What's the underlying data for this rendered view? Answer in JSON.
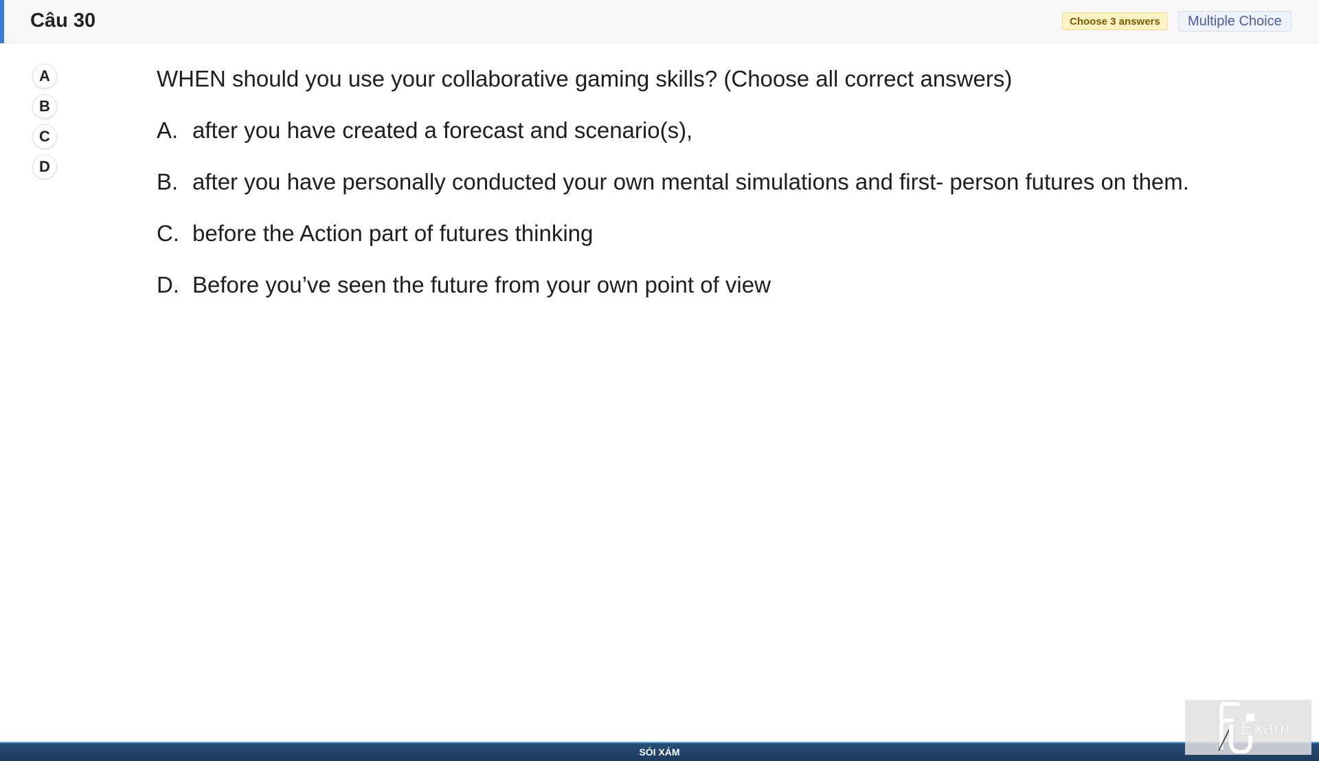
{
  "header": {
    "question_number": "Câu 30",
    "choose_badge": "Choose 3 answers",
    "type_badge": "Multiple Choice",
    "accent_color": "#3b7dd8"
  },
  "choices": [
    "A",
    "B",
    "C",
    "D"
  ],
  "question": {
    "text": "WHEN should you use your collaborative gaming skills? (Choose all correct answers)",
    "options": [
      {
        "letter": "A.",
        "text": "after you have created a forecast and scenario(s),"
      },
      {
        "letter": "B.",
        "text": "after you have personally conducted your own mental simulations and first- person futures on them."
      },
      {
        "letter": "C.",
        "text": "before the Action part of futures thinking"
      },
      {
        "letter": "D.",
        "text": "Before you’ve seen the future from your own point of view"
      }
    ]
  },
  "footer": {
    "text": "SÓI XÁM"
  },
  "logo": {
    "text": "FU Exam",
    "icon": "fu-exam-logo"
  }
}
